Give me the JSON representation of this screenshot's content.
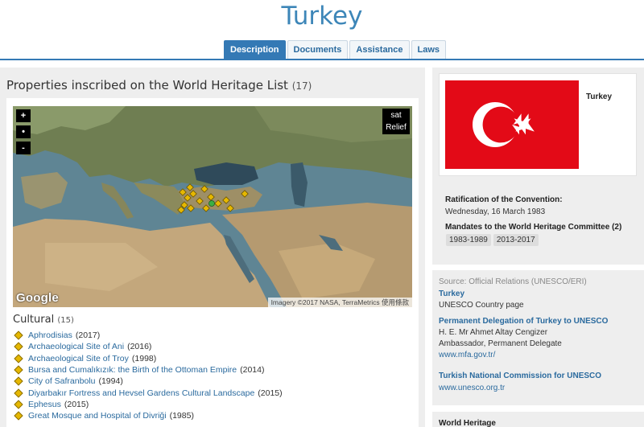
{
  "page": {
    "title": "Turkey"
  },
  "tabs": [
    {
      "label": "Description",
      "active": true
    },
    {
      "label": "Documents",
      "active": false
    },
    {
      "label": "Assistance",
      "active": false
    },
    {
      "label": "Laws",
      "active": false
    }
  ],
  "list": {
    "heading": "Properties inscribed on the World Heritage List",
    "count": "(17)"
  },
  "map": {
    "zoom_in": "+",
    "center": "•",
    "zoom_out": "-",
    "type_sat": "sat",
    "type_relief": "Relief",
    "logo": "Google",
    "attribution": "Imagery ©2017 NASA, TerraMetrics  使用條款"
  },
  "cultural": {
    "heading": "Cultural",
    "count": "(15)",
    "sites": [
      {
        "name": "Aphrodisias",
        "year": "(2017)"
      },
      {
        "name": "Archaeological Site of Ani",
        "year": "(2016)"
      },
      {
        "name": "Archaeological Site of Troy",
        "year": "(1998)"
      },
      {
        "name": "Bursa and Cumalıkızık: the Birth of the Ottoman Empire",
        "year": "(2014)"
      },
      {
        "name": "City of Safranbolu",
        "year": "(1994)"
      },
      {
        "name": "Diyarbakır Fortress and Hevsel Gardens Cultural Landscape",
        "year": "(2015)"
      },
      {
        "name": "Ephesus",
        "year": "(2015)"
      },
      {
        "name": "Great Mosque and Hospital of Divriği",
        "year": "(1985)"
      }
    ]
  },
  "country": {
    "name": "Turkey",
    "ratification_label": "Ratification of the Convention:",
    "ratification_date": "Wednesday, 16 March 1983",
    "mandates_label": "Mandates to the World Heritage Committee (2)",
    "mandates": [
      "1983-1989",
      "2013-2017"
    ]
  },
  "source": {
    "label": "Source: Official Relations (UNESCO/ERI)",
    "country_link": "Turkey",
    "country_page": "UNESCO Country page",
    "delegation_title": "Permanent Delegation of Turkey to UNESCO",
    "delegate_name": "H. E. Mr Ahmet Altay Cengizer",
    "delegate_role": "Ambassador, Permanent Delegate",
    "delegation_url": "www.mfa.gov.tr/",
    "commission_title": "Turkish National Commission for UNESCO",
    "commission_url": "www.unesco.org.tr"
  },
  "world_heritage": {
    "label": "World Heritage"
  },
  "colors": {
    "accent": "#3479b5",
    "link": "#2a6a9e",
    "flag_red": "#e30a17",
    "marker": "#e6b800"
  }
}
